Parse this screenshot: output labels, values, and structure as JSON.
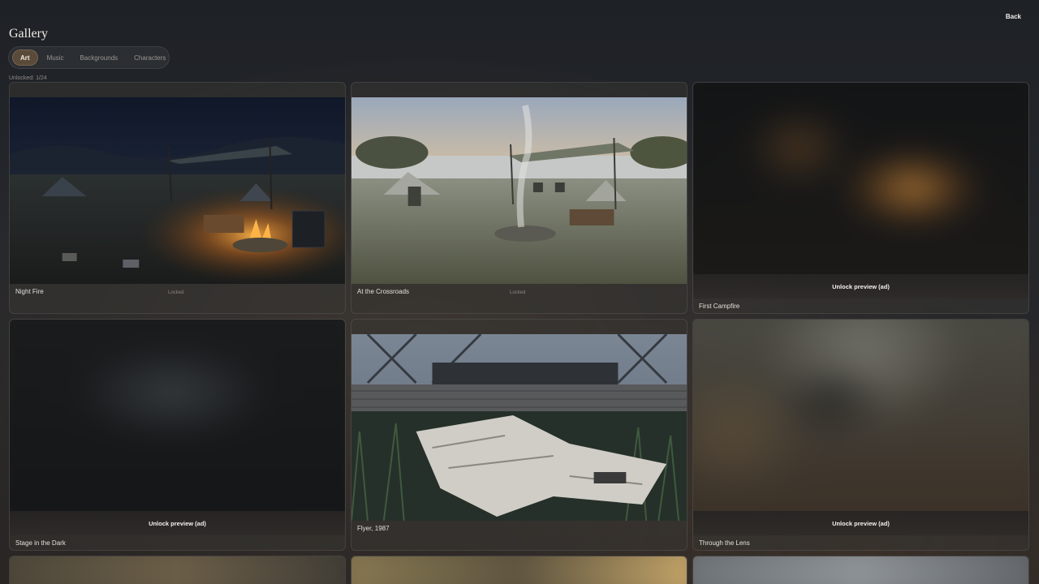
{
  "header": {
    "title": "Gallery",
    "back_label": "Back"
  },
  "tabs": [
    {
      "label": "Art",
      "active": true
    },
    {
      "label": "Music",
      "active": false
    },
    {
      "label": "Backgrounds",
      "active": false
    },
    {
      "label": "Characters",
      "active": false
    }
  ],
  "unlocked_text": "Unlocked: 1/24",
  "cards": [
    {
      "title": "Night Fire",
      "status": "Locked",
      "state": "visible"
    },
    {
      "title": "At the Crossroads",
      "status": "Locked",
      "state": "visible"
    },
    {
      "title": "First Campfire",
      "action": "Unlock preview (ad)",
      "state": "locked"
    },
    {
      "title": "Stage in the Dark",
      "action": "Unlock preview (ad)",
      "state": "locked"
    },
    {
      "title": "Flyer, 1987",
      "state": "visible"
    },
    {
      "title": "Through the Lens",
      "action": "Unlock preview (ad)",
      "state": "locked"
    }
  ],
  "colors": {
    "accent_tab": "#5a4a3a",
    "background": "#23252a",
    "card": "#37342f"
  }
}
